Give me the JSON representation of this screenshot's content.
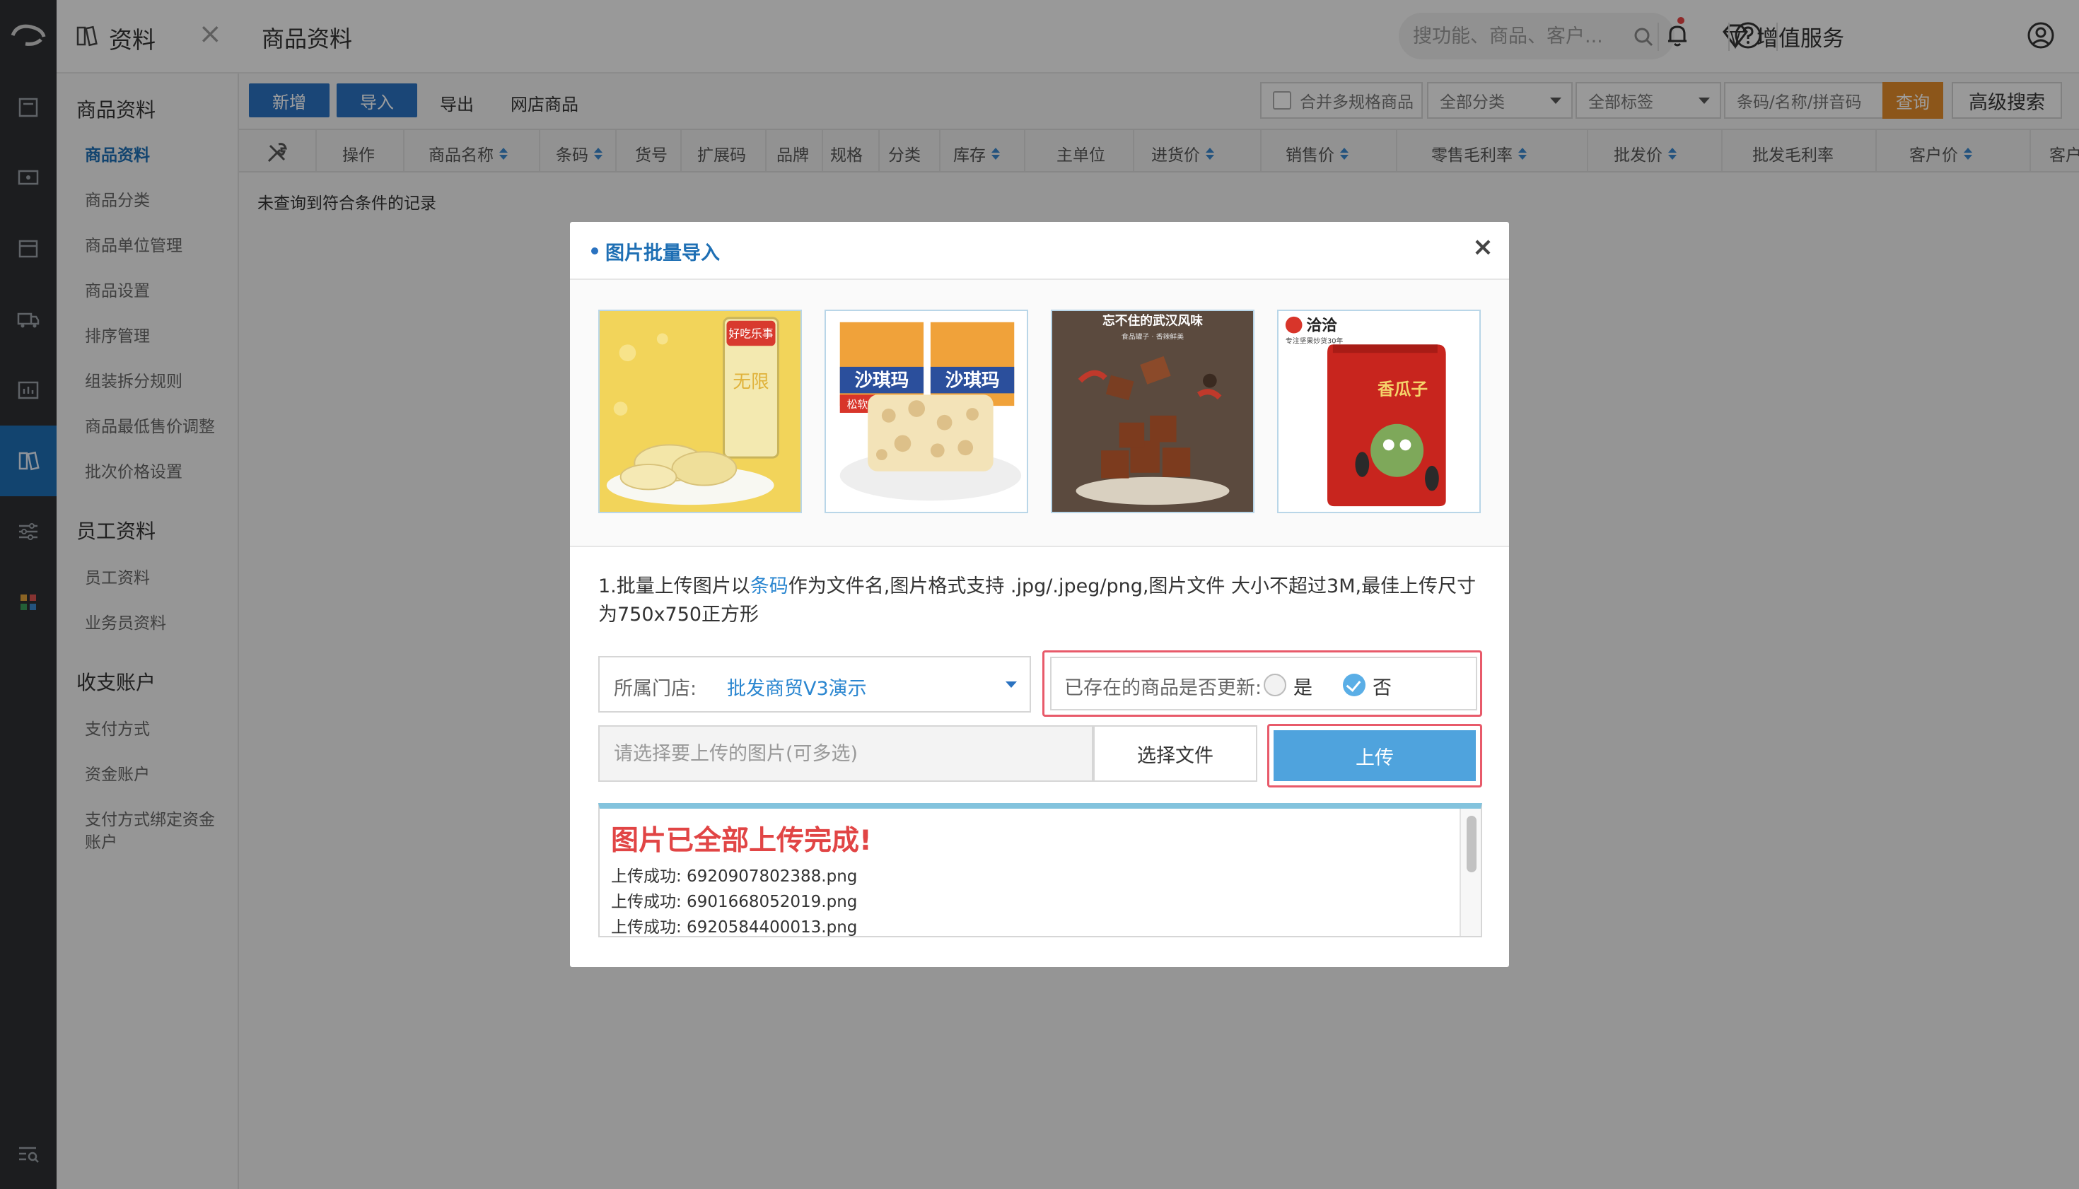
{
  "sidebar": {
    "title": "资料",
    "close": "×",
    "groups": [
      {
        "label": "商品资料",
        "items": [
          "商品资料",
          "商品分类",
          "商品单位管理",
          "商品设置",
          "排序管理",
          "组装拆分规则",
          "商品最低售价调整",
          "批次价格设置"
        ]
      },
      {
        "label": "员工资料",
        "items": [
          "员工资料",
          "业务员资料"
        ]
      },
      {
        "label": "收支账户",
        "items": [
          "支付方式",
          "资金账户",
          "支付方式绑定资金",
          "账户"
        ]
      }
    ],
    "active_item": "商品资料"
  },
  "topbar": {
    "page_title": "商品资料",
    "search_placeholder": "搜功能、商品、客户...",
    "vip_label": "增值服务"
  },
  "toolbar": {
    "add": "新增",
    "import": "导入",
    "export": "导出",
    "online_goods": "网店商品",
    "merge_label": "合并多规格商品",
    "category": "全部分类",
    "tags": "全部标签",
    "code_placeholder": "条码/名称/拼音码",
    "query": "查询",
    "advanced": "高级搜索"
  },
  "table": {
    "columns": [
      "操作",
      "商品名称",
      "条码",
      "货号",
      "扩展码",
      "品牌",
      "规格",
      "分类",
      "库存",
      "主单位",
      "进货价",
      "销售价",
      "零售毛利率",
      "批发价",
      "批发毛利率",
      "客户价",
      "客户"
    ],
    "empty_message": "未查询到符合条件的记录"
  },
  "modal": {
    "title": "图片批量导入",
    "close": "×",
    "sample_images": [
      "potato-chips-can",
      "sachima-pastry",
      "spicy-tofu-snack",
      "red-sunflower-seeds-bag"
    ],
    "sample_texts": {
      "chips_brand": "好吃乐事",
      "chips_name": "无限",
      "pastry_brand": "沙琪玛",
      "pastry_tag": "松软",
      "tofu_headline": "忘不住的武汉风味",
      "tofu_sub": "食品罐子 · 香辣鲜美",
      "seeds_brand": "洽洽",
      "seeds_slogan": "专注坚果炒货30年",
      "seeds_name": "香瓜子"
    },
    "note_prefix": "1.批量上传图片以",
    "note_highlight": "条码",
    "note_rest": "作为文件名,图片格式支持 .jpg/.jpeg/png,图片文件 大小不超过3M,最佳上传尺寸为750x750正方形",
    "store_label": "所属门店:",
    "store_value": "批发商贸V3演示",
    "update_label": "已存在的商品是否更新:",
    "yes": "是",
    "no": "否",
    "file_placeholder": "请选择要上传的图片(可多选)",
    "choose_file": "选择文件",
    "upload": "上传",
    "log_title": "图片已全部上传完成!",
    "log_lines": [
      "上传成功:  6920907802388.png",
      "上传成功:  6901668052019.png",
      "上传成功:  6920584400013.png"
    ]
  },
  "colors": {
    "rail": "#2e3033",
    "accent_blue": "#2a72c0",
    "upload_blue": "#4fa3dd",
    "highlight_red": "#e85a6a",
    "success_red": "#e14545",
    "query_orange": "#e38c2a"
  }
}
